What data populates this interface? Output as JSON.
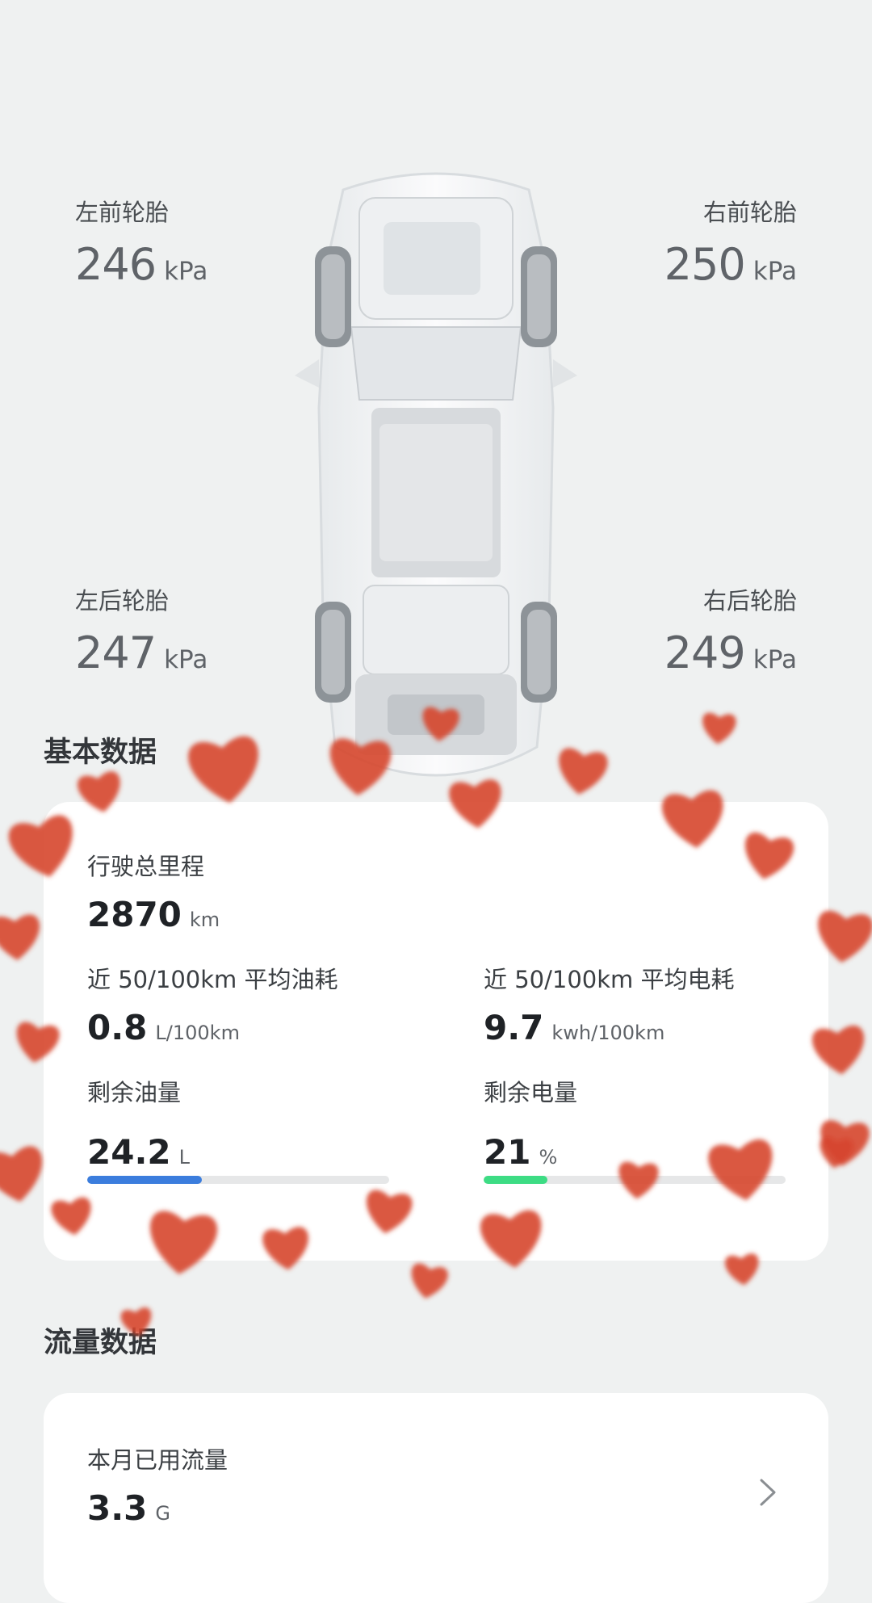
{
  "tires": {
    "front_left": {
      "label": "左前轮胎",
      "value": "246",
      "unit": "kPa"
    },
    "front_right": {
      "label": "右前轮胎",
      "value": "250",
      "unit": "kPa"
    },
    "rear_left": {
      "label": "左后轮胎",
      "value": "247",
      "unit": "kPa"
    },
    "rear_right": {
      "label": "右后轮胎",
      "value": "249",
      "unit": "kPa"
    }
  },
  "basic": {
    "title": "基本数据",
    "odometer": {
      "label": "行驶总里程",
      "value": "2870",
      "unit": "km"
    },
    "fuel_avg": {
      "label": "近 50/100km 平均油耗",
      "value": "0.8",
      "unit": "L/100km"
    },
    "elec_avg": {
      "label": "近 50/100km 平均电耗",
      "value": "9.7",
      "unit": "kwh/100km"
    },
    "fuel_left": {
      "label": "剩余油量",
      "value": "24.2",
      "unit": "L",
      "fill_fraction": 0.38,
      "color": "#3b7ddd"
    },
    "battery_left": {
      "label": "剩余电量",
      "value": "21",
      "unit": "%",
      "fill_fraction": 0.21,
      "color": "#3ddc84"
    }
  },
  "flow": {
    "title": "流量数据",
    "month_used": {
      "label": "本月已用流量",
      "value": "3.3",
      "unit": "G"
    }
  },
  "colors": {
    "heart": "#d6452e",
    "background": "#eff1f1"
  }
}
